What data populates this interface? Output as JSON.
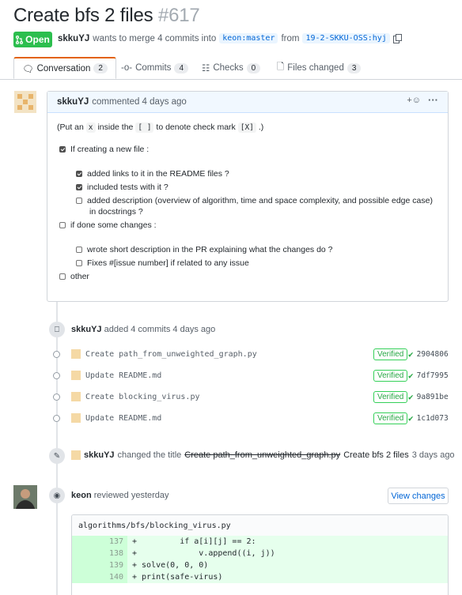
{
  "pr": {
    "title": "Create bfs 2 files",
    "number": "#617",
    "status": "Open",
    "author": "skkuYJ",
    "merge_text": "wants to merge 4 commits into",
    "base_branch": "keon:master",
    "from_text": "from",
    "head_branch": "19-2-SKKU-OSS:hyj"
  },
  "tabs": [
    {
      "label": "Conversation",
      "count": "2"
    },
    {
      "label": "Commits",
      "count": "4"
    },
    {
      "label": "Checks",
      "count": "0"
    },
    {
      "label": "Files changed",
      "count": "3"
    }
  ],
  "comment": {
    "author": "skkuYJ",
    "action": "commented 4 days ago",
    "intro_a": "(Put an",
    "intro_x": "x",
    "intro_b": "inside the",
    "intro_brackets": "[ ]",
    "intro_c": "to denote check mark",
    "intro_mark": "[X]",
    "intro_d": ".)",
    "items": [
      {
        "label": "If creating a new file :",
        "checked": true
      },
      {
        "label": "added links to it in the README files ?",
        "checked": true
      },
      {
        "label": "included tests with it ?",
        "checked": true
      },
      {
        "label": "added description (overview of algorithm, time and space complexity, and possible edge case)",
        "label2": "in docstrings ?",
        "checked": false
      },
      {
        "label": "if done some changes :",
        "checked": false
      },
      {
        "label": "wrote short description in the PR explaining what the changes do ?",
        "checked": false
      },
      {
        "label": "Fixes #[issue number] if related to any issue",
        "checked": false
      },
      {
        "label": "other",
        "checked": false
      }
    ]
  },
  "commits_event": {
    "author": "skkuYJ",
    "text": "added 4 commits 4 days ago",
    "commits": [
      {
        "message": "Create path_from_unweighted_graph.py",
        "verified": "Verified",
        "sha": "2904806"
      },
      {
        "message": "Update README.md",
        "verified": "Verified",
        "sha": "7df7995"
      },
      {
        "message": "Create blocking_virus.py",
        "verified": "Verified",
        "sha": "9a891be"
      },
      {
        "message": "Update README.md",
        "verified": "Verified",
        "sha": "1c1d073"
      }
    ]
  },
  "rename_event": {
    "author": "skkuYJ",
    "text": "changed the title",
    "old_title": "Create path_from_unweighted_graph.py",
    "new_title": "Create bfs 2 files",
    "time": "3 days ago"
  },
  "review_event": {
    "author": "keon",
    "text": "reviewed yesterday",
    "button": "View changes",
    "file": "algorithms/bfs/blocking_virus.py",
    "lines": [
      {
        "num": "137",
        "code": "+         if a[i][j] == 2:"
      },
      {
        "num": "138",
        "code": "+             v.append((i, j))"
      },
      {
        "num": "139",
        "code": "+ solve(0, 0, 0)"
      },
      {
        "num": "140",
        "code": "+ print(safe-virus)"
      }
    ]
  },
  "colors": {
    "open": "#2cbe4e",
    "link": "#0366d6",
    "verified": "#28a745",
    "tab_accent": "#e36209"
  }
}
